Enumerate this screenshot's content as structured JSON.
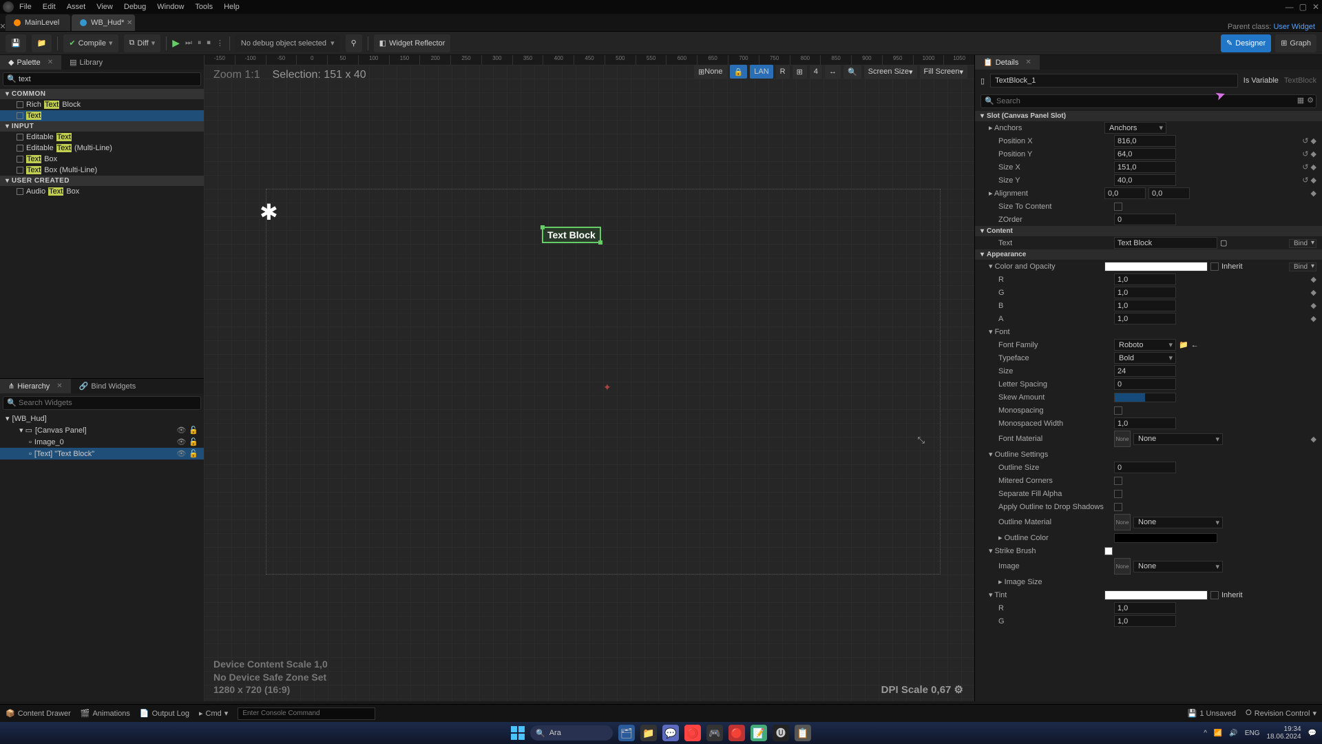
{
  "menu": {
    "file": "File",
    "edit": "Edit",
    "asset": "Asset",
    "view": "View",
    "debug": "Debug",
    "window": "Window",
    "tools": "Tools",
    "help": "Help"
  },
  "tabs": {
    "main": "MainLevel",
    "hud": "WB_Hud*"
  },
  "parent_class": {
    "label": "Parent class:",
    "value": "User Widget"
  },
  "toolbar": {
    "compile": "Compile",
    "diff": "Diff",
    "nodebug": "No debug object selected",
    "reflector": "Widget Reflector",
    "designer": "Designer",
    "graph": "Graph"
  },
  "palette": {
    "tab": "Palette",
    "library": "Library",
    "search": "text",
    "groups": {
      "common": "COMMON",
      "input": "INPUT",
      "user": "USER CREATED"
    },
    "common": [
      {
        "pre": "Rich ",
        "hl": "Text",
        "post": " Block"
      },
      {
        "pre": "",
        "hl": "Text",
        "post": ""
      }
    ],
    "input": [
      {
        "pre": "Editable ",
        "hl": "Text",
        "post": ""
      },
      {
        "pre": "Editable ",
        "hl": "Text",
        "post": " (Multi-Line)"
      },
      {
        "pre": "",
        "hl": "Text",
        "post": " Box"
      },
      {
        "pre": "",
        "hl": "Text",
        "post": " Box (Multi-Line)"
      }
    ],
    "user": [
      {
        "pre": "Audio ",
        "hl": "Text",
        "post": " Box"
      }
    ]
  },
  "hierarchy": {
    "tab": "Hierarchy",
    "bind": "Bind Widgets",
    "search_ph": "Search Widgets",
    "root": "[WB_Hud]",
    "canvas": "[Canvas Panel]",
    "image": "Image_0",
    "text": "[Text] \"Text Block\""
  },
  "canvas": {
    "zoom": "Zoom 1:1",
    "selection": "Selection: 151 x 40",
    "none": "None",
    "lan": "LAN",
    "r": "R",
    "num": "4",
    "screen": "Screen Size",
    "fill": "Fill Screen",
    "widget_text": "Text Block",
    "ruler": [
      "-150",
      "-100",
      "-50",
      "0",
      "50",
      "100",
      "150",
      "200",
      "250",
      "300",
      "350",
      "400",
      "450",
      "500",
      "550",
      "600",
      "650",
      "700",
      "750",
      "800",
      "850",
      "900",
      "950",
      "1000",
      "1050"
    ],
    "info1": "Device Content Scale 1,0",
    "info2": "No Device Safe Zone Set",
    "info3": "1280 x 720 (16:9)",
    "dpi": "DPI Scale 0,67"
  },
  "details": {
    "tab": "Details",
    "name": "TextBlock_1",
    "isvar": "Is Variable",
    "type": "TextBlock",
    "search_ph": "Search",
    "slot_header": "Slot (Canvas Panel Slot)",
    "anchors": "Anchors",
    "anchors_val": "Anchors",
    "posx": "Position X",
    "posx_v": "816,0",
    "posy": "Position Y",
    "posy_v": "64,0",
    "sizex": "Size X",
    "sizex_v": "151,0",
    "sizey": "Size Y",
    "sizey_v": "40,0",
    "align": "Alignment",
    "align_x": "0,0",
    "align_y": "0,0",
    "stc": "Size To Content",
    "zorder": "ZOrder",
    "zorder_v": "0",
    "content": "Content",
    "text": "Text",
    "text_v": "Text Block",
    "bind": "Bind",
    "appearance": "Appearance",
    "colorop": "Color and Opacity",
    "inherit": "Inherit",
    "r": "R",
    "g": "G",
    "b": "B",
    "a": "A",
    "one": "1,0",
    "font": "Font",
    "family": "Font Family",
    "family_v": "Roboto",
    "typeface": "Typeface",
    "typeface_v": "Bold",
    "size": "Size",
    "size_v": "24",
    "letter": "Letter Spacing",
    "letter_v": "0",
    "skew": "Skew Amount",
    "skew_v": "0,0",
    "mono": "Monospacing",
    "monow": "Monospaced Width",
    "monow_v": "1,0",
    "fontmat": "Font Material",
    "none": "None",
    "outline": "Outline Settings",
    "outsize": "Outline Size",
    "outsize_v": "0",
    "mitered": "Mitered Corners",
    "sepfill": "Separate Fill Alpha",
    "applyout": "Apply Outline to Drop Shadows",
    "outmat": "Outline Material",
    "outcolor": "Outline Color",
    "strike": "Strike Brush",
    "image": "Image",
    "imgsize": "Image Size",
    "tint": "Tint"
  },
  "status": {
    "drawer": "Content Drawer",
    "anim": "Animations",
    "output": "Output Log",
    "cmd": "Cmd",
    "cmd_ph": "Enter Console Command",
    "unsaved": "1 Unsaved",
    "revision": "Revision Control"
  },
  "taskbar": {
    "search": "Ara",
    "time": "19:34",
    "date": "18.06.2024"
  }
}
